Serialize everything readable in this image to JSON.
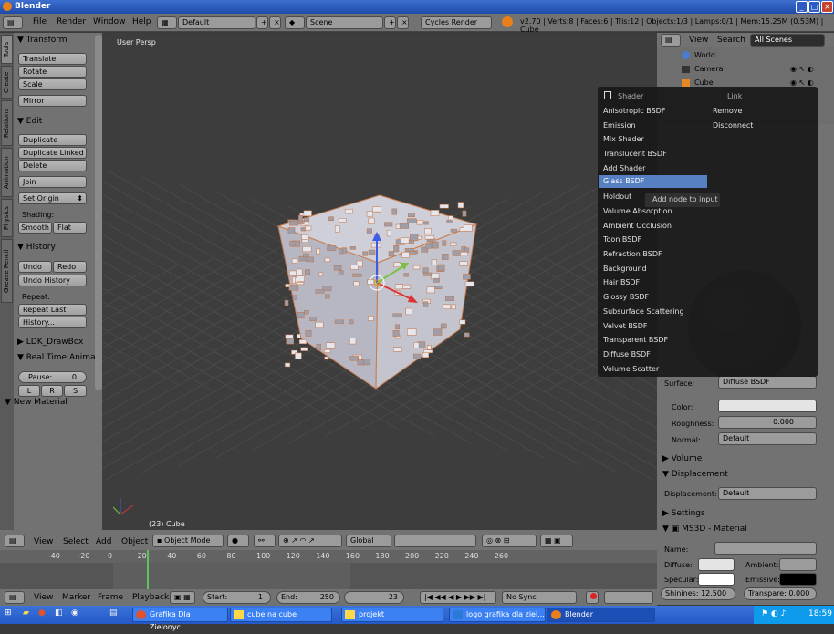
{
  "window": {
    "title": "Blender"
  },
  "infobar": {
    "menus": [
      "File",
      "Render",
      "Window",
      "Help"
    ],
    "layout": "Default",
    "scene": "Scene",
    "engine": "Cycles Render",
    "stats": "v2.70 | Verts:8 | Faces:6 | Tris:12 | Objects:1/3 | Lamps:0/1 | Mem:15.25M (0.53M) | Cube"
  },
  "tabs": [
    "Tools",
    "Create",
    "Relations",
    "Animation",
    "Physics",
    "Grease Pencil"
  ],
  "toolshelf": {
    "transform": {
      "title": "Transform",
      "buttons": [
        "Translate",
        "Rotate",
        "Scale",
        "Mirror"
      ]
    },
    "edit": {
      "title": "Edit",
      "buttons": [
        "Duplicate",
        "Duplicate Linked",
        "Delete",
        "Join"
      ],
      "set_origin": "Set Origin",
      "shading_label": "Shading:",
      "smooth": "Smooth",
      "flat": "Flat"
    },
    "history": {
      "title": "History",
      "undo": "Undo",
      "redo": "Redo",
      "undo_history": "Undo History",
      "repeat_label": "Repeat:",
      "repeat_last": "Repeat Last",
      "history": "History..."
    },
    "drawbox": {
      "title": "LDK_DrawBox"
    },
    "realtime": {
      "title": "Real Time Anima",
      "pause_label": "Pause:",
      "pause_value": "0",
      "l": "L",
      "r": "R",
      "s": "S"
    },
    "new_material": "New Material"
  },
  "viewport": {
    "view_label": "User Persp",
    "object_label": "(23) Cube",
    "colors": {
      "bg": "#3d3d3d",
      "grid": "#4a4a4a",
      "axis_x": "#d33",
      "axis_y": "#7ac143",
      "axis_z": "#3d5ce8"
    }
  },
  "popup": {
    "header_left": "Shader",
    "header_right": "Link",
    "items": [
      "Anisotropic BSDF",
      "Emission",
      "Mix Shader",
      "Translucent BSDF",
      "Add Shader",
      "Glass BSDF",
      "Holdout",
      "Volume Absorption",
      "Ambient Occlusion",
      "Toon BSDF",
      "Refraction BSDF",
      "Background",
      "Hair BSDF",
      "Glossy BSDF",
      "Subsurface Scattering",
      "Velvet BSDF",
      "Transparent BSDF",
      "Diffuse BSDF",
      "Volume Scatter"
    ],
    "selected_index": 5,
    "link_items": [
      "Remove",
      "Disconnect"
    ],
    "tooltip": "Add node to input"
  },
  "outliner": {
    "menus": [
      "View",
      "Search"
    ],
    "filter": "All Scenes",
    "rows": [
      "World",
      "Camera",
      "Cube"
    ]
  },
  "props": {
    "surface_label": "Surface:",
    "surface_value": "Diffuse BSDF",
    "color_label": "Color:",
    "roughness_label": "Roughness:",
    "roughness_value": "0.000",
    "normal_label": "Normal:",
    "normal_value": "Default",
    "volume": "Volume",
    "displacement": "Displacement",
    "displacement_label": "Displacement:",
    "displacement_value": "Default",
    "settings": "Settings",
    "ms3d": "MS3D - Material",
    "name_label": "Name:",
    "diffuse_label": "Diffuse:",
    "ambient_label": "Ambient:",
    "specular_label": "Specular:",
    "emissive_label": "Emissive:",
    "shininess": "Shinines: 12.500",
    "transparency": "Transpare: 0.000"
  },
  "vheader": {
    "menus": [
      "View",
      "Select",
      "Add",
      "Object"
    ],
    "mode": "Object Mode",
    "orientation": "Global"
  },
  "timeline": {
    "ticks": [
      "-40",
      "-20",
      "0",
      "20",
      "40",
      "60",
      "80",
      "100",
      "120",
      "140",
      "160",
      "180",
      "200",
      "220",
      "240",
      "260"
    ],
    "current_frame": 23
  },
  "tlheader": {
    "menus": [
      "View",
      "Marker",
      "Frame",
      "Playback"
    ],
    "start": "Start:",
    "start_val": "1",
    "end": "End:",
    "end_val": "250",
    "frame": "23",
    "sync": "No Sync"
  },
  "taskbar": {
    "tasks": [
      "Grafika Dla Zielonyc...",
      "cube na cube",
      "projekt",
      "logo grafika dla ziel...",
      "Blender"
    ],
    "clock": "18:59"
  }
}
